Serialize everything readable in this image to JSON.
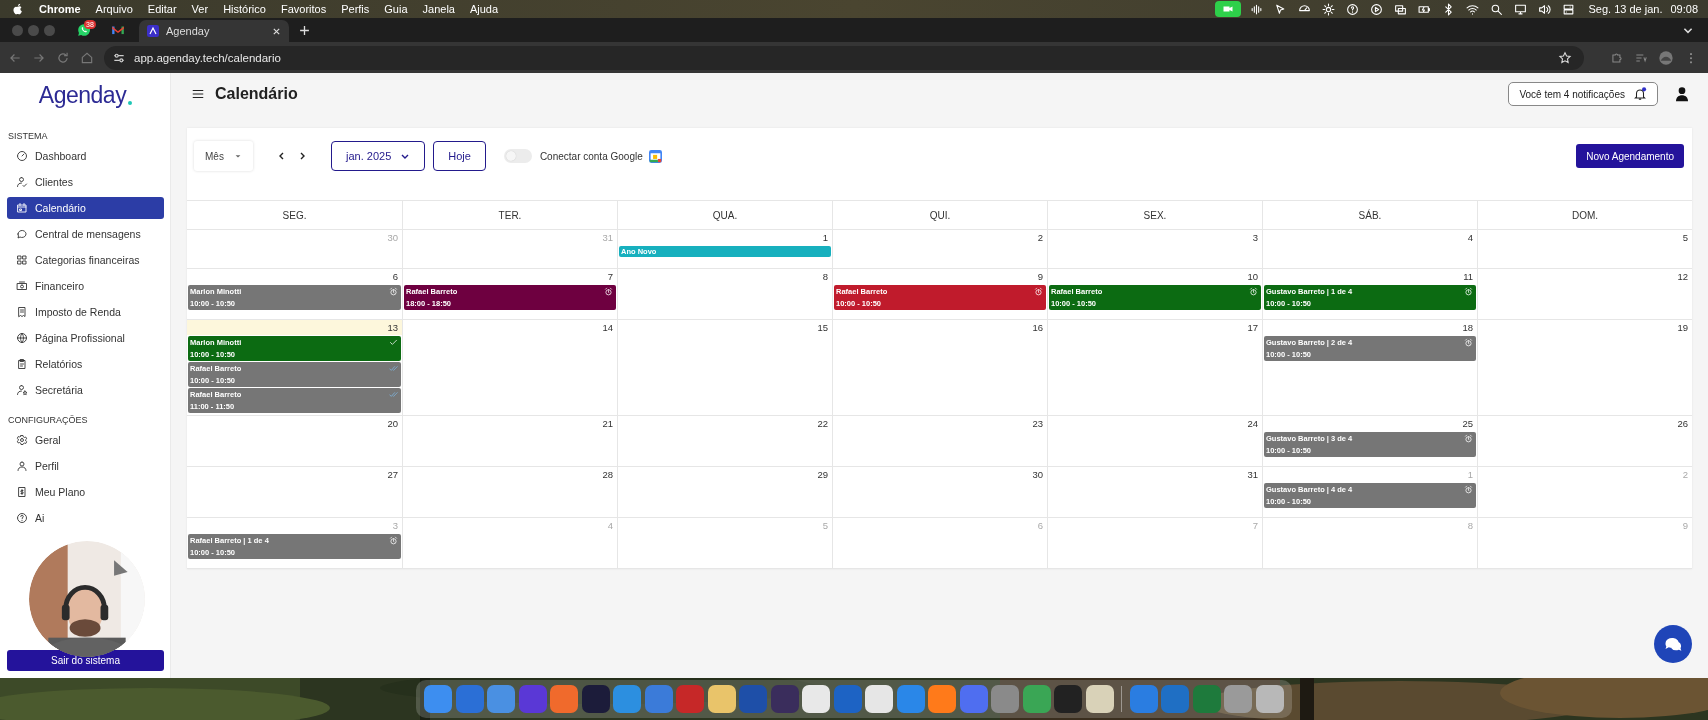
{
  "menubar": {
    "app": "Chrome",
    "menus": [
      "Arquivo",
      "Editar",
      "Ver",
      "Histórico",
      "Favoritos",
      "Perfis",
      "Guia",
      "Janela",
      "Ajuda"
    ],
    "date": "Seg. 13 de jan.",
    "time": "09:08"
  },
  "browser": {
    "tabs": [
      {
        "kind": "chat",
        "badge": "38",
        "selected": false
      },
      {
        "kind": "mail",
        "selected": false
      },
      {
        "kind": "page",
        "title": "Agenday",
        "selected": true
      }
    ],
    "url": "app.agenday.tech/calendario"
  },
  "sidebar": {
    "logo": "Agenday",
    "sections": [
      {
        "title": "SISTEMA",
        "items": [
          {
            "label": "Dashboard",
            "kind": "dashboard",
            "selected": false
          },
          {
            "label": "Clientes",
            "kind": "clients",
            "selected": false
          },
          {
            "label": "Calendário",
            "kind": "calendar",
            "selected": true
          },
          {
            "label": "Central de mensagens",
            "kind": "messages",
            "selected": false
          },
          {
            "label": "Categorias financeiras",
            "kind": "categories",
            "selected": false
          },
          {
            "label": "Financeiro",
            "kind": "finance",
            "selected": false
          },
          {
            "label": "Imposto de Renda",
            "kind": "tax",
            "selected": false
          },
          {
            "label": "Página Profissional",
            "kind": "globe",
            "selected": false
          },
          {
            "label": "Relatórios",
            "kind": "reports",
            "selected": false
          },
          {
            "label": "Secretária",
            "kind": "secretary",
            "selected": false
          }
        ]
      },
      {
        "title": "CONFIGURAÇÕES",
        "items": [
          {
            "label": "Geral",
            "kind": "settings",
            "selected": false
          },
          {
            "label": "Perfil",
            "kind": "profile",
            "selected": false
          },
          {
            "label": "Meu Plano",
            "kind": "plan",
            "selected": false
          },
          {
            "label": "Ai",
            "kind": "help",
            "selected": false
          }
        ]
      }
    ],
    "logout": "Sair do sistema"
  },
  "header": {
    "title": "Calendário",
    "notifications": "Você tem 4 notificações",
    "unread": true
  },
  "toolbar": {
    "view": "Mês",
    "month": "jan. 2025",
    "today": "Hoje",
    "google": {
      "label": "Conectar conta Google",
      "on": false
    },
    "new_button": "Novo Agendamento"
  },
  "calendar": {
    "weekdays": [
      "SEG.",
      "TER.",
      "QUA.",
      "QUI.",
      "SEX.",
      "SÁB.",
      "DOM."
    ],
    "weeks": [
      {
        "days": [
          {
            "day": "30",
            "muted": true,
            "today": false
          },
          {
            "day": "31",
            "muted": true,
            "today": false
          },
          {
            "day": "1",
            "muted": false,
            "today": false,
            "events": [
              {
                "title": "Ano Novo",
                "color": "#17b0be"
              }
            ]
          },
          {
            "day": "2",
            "muted": false,
            "today": false
          },
          {
            "day": "3",
            "muted": false,
            "today": false
          },
          {
            "day": "4",
            "muted": false,
            "today": false
          },
          {
            "day": "5",
            "muted": false,
            "today": false
          }
        ]
      },
      {
        "days": [
          {
            "day": "6",
            "muted": false,
            "today": false,
            "events": [
              {
                "title": "Marlon Minotti",
                "time": "10:00 - 10:50",
                "color": "#767676",
                "kind": "alarm"
              }
            ]
          },
          {
            "day": "7",
            "muted": false,
            "today": false,
            "events": [
              {
                "title": "Rafael Barreto",
                "time": "18:00 - 18:50",
                "color": "#6e0040",
                "kind": "alarm"
              }
            ]
          },
          {
            "day": "8",
            "muted": false,
            "today": false
          },
          {
            "day": "9",
            "muted": false,
            "today": false,
            "events": [
              {
                "title": "Rafael Barreto",
                "time": "10:00 - 10:50",
                "color": "#c01b2c",
                "kind": "alarm"
              }
            ]
          },
          {
            "day": "10",
            "muted": false,
            "today": false,
            "events": [
              {
                "title": "Rafael Barreto",
                "time": "10:00 - 10:50",
                "color": "#0c6b12",
                "kind": "alarm"
              }
            ]
          },
          {
            "day": "11",
            "muted": false,
            "today": false,
            "events": [
              {
                "title": "Gustavo Barreto | 1 de 4",
                "time": "10:00 - 10:50",
                "color": "#0c6b12",
                "kind": "alarm"
              }
            ]
          },
          {
            "day": "12",
            "muted": false,
            "today": false
          }
        ]
      },
      {
        "days": [
          {
            "day": "13",
            "muted": false,
            "today": true,
            "events": [
              {
                "title": "Marlon Minotti",
                "time": "10:00 - 10:50",
                "color": "#0c6b12",
                "kind": "check"
              },
              {
                "title": "Rafael Barreto",
                "time": "10:00 - 10:50",
                "color": "#767676",
                "kind": "double_check"
              },
              {
                "title": "Rafael Barreto",
                "time": "11:00 - 11:50",
                "color": "#767676",
                "kind": "double_check"
              }
            ]
          },
          {
            "day": "14",
            "muted": false,
            "today": false
          },
          {
            "day": "15",
            "muted": false,
            "today": false
          },
          {
            "day": "16",
            "muted": false,
            "today": false
          },
          {
            "day": "17",
            "muted": false,
            "today": false
          },
          {
            "day": "18",
            "muted": false,
            "today": false,
            "events": [
              {
                "title": "Gustavo Barreto | 2 de 4",
                "time": "10:00 - 10:50",
                "color": "#767676",
                "kind": "alarm"
              }
            ]
          },
          {
            "day": "19",
            "muted": false,
            "today": false
          }
        ]
      },
      {
        "days": [
          {
            "day": "20",
            "muted": false,
            "today": false
          },
          {
            "day": "21",
            "muted": false,
            "today": false
          },
          {
            "day": "22",
            "muted": false,
            "today": false
          },
          {
            "day": "23",
            "muted": false,
            "today": false
          },
          {
            "day": "24",
            "muted": false,
            "today": false
          },
          {
            "day": "25",
            "muted": false,
            "today": false,
            "events": [
              {
                "title": "Gustavo Barreto | 3 de 4",
                "time": "10:00 - 10:50",
                "color": "#767676",
                "kind": "alarm"
              }
            ]
          },
          {
            "day": "26",
            "muted": false,
            "today": false
          }
        ]
      },
      {
        "days": [
          {
            "day": "27",
            "muted": false,
            "today": false
          },
          {
            "day": "28",
            "muted": false,
            "today": false
          },
          {
            "day": "29",
            "muted": false,
            "today": false
          },
          {
            "day": "30",
            "muted": false,
            "today": false
          },
          {
            "day": "31",
            "muted": false,
            "today": false
          },
          {
            "day": "1",
            "muted": true,
            "today": false,
            "events": [
              {
                "title": "Gustavo Barreto | 4 de 4",
                "time": "10:00 - 10:50",
                "color": "#767676",
                "kind": "alarm"
              }
            ]
          },
          {
            "day": "2",
            "muted": true,
            "today": false
          }
        ]
      },
      {
        "days": [
          {
            "day": "3",
            "muted": true,
            "today": false,
            "events": [
              {
                "title": "Rafael Barreto | 1 de 4",
                "time": "10:00 - 10:50",
                "color": "#767676",
                "kind": "alarm"
              }
            ]
          },
          {
            "day": "4",
            "muted": true,
            "today": false
          },
          {
            "day": "5",
            "muted": true,
            "today": false
          },
          {
            "day": "6",
            "muted": true,
            "today": false
          },
          {
            "day": "7",
            "muted": true,
            "today": false
          },
          {
            "day": "8",
            "muted": true,
            "today": false
          },
          {
            "day": "9",
            "muted": true,
            "today": false
          }
        ]
      }
    ]
  }
}
